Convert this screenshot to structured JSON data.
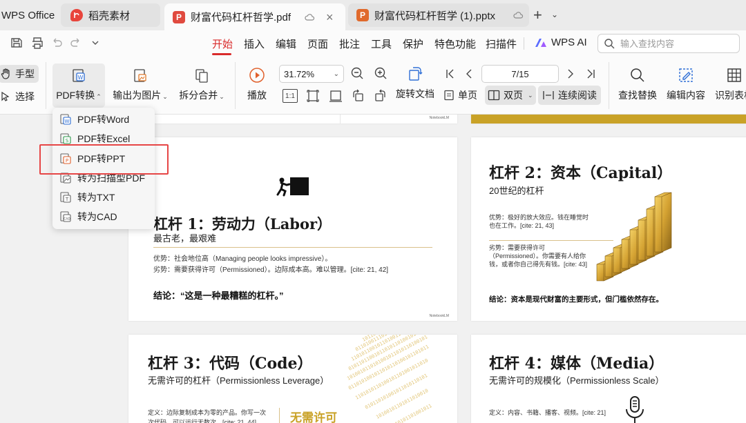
{
  "tabs": {
    "home": "WPS Office",
    "docer": "稻壳素材",
    "active_pdf": "财富代码杠杆哲学.pdf",
    "pptx": "财富代码杠杆哲学 (1).pptx",
    "pdf_badge": "P",
    "pptx_badge": "P"
  },
  "menu": {
    "items": [
      "开始",
      "插入",
      "编辑",
      "页面",
      "批注",
      "工具",
      "保护",
      "特色功能",
      "扫描件"
    ],
    "active": "开始",
    "wps_ai": "WPS AI",
    "search_placeholder": "输入查找内容"
  },
  "ribbon": {
    "hand": "手型",
    "select": "选择",
    "pdf_convert": "PDF转换",
    "export_image": "输出为图片",
    "split_merge": "拆分合并",
    "play": "播放",
    "zoom": "31.72%",
    "rotate_doc": "旋转文档",
    "single_page": "单页",
    "double_page": "双页",
    "continuous": "连续阅读",
    "page_indicator": "7/15",
    "find_replace": "查找替换",
    "edit_content": "编辑内容",
    "recognize_table": "识别表格",
    "actual_size": "1:1"
  },
  "dropdown": {
    "items": [
      "PDF转Word",
      "PDF转Excel",
      "PDF转PPT",
      "转为扫描型PDF",
      "转为TXT",
      "转为CAD"
    ],
    "highlighted": "PDF转PPT"
  },
  "slides": {
    "watermark": "NotebookLM",
    "labor": {
      "title": "杠杆 1：劳动力（Labor）",
      "subtitle": "最古老，最艰难",
      "pro": "优势：社会地位高（Managing people looks impressive）。",
      "con": "劣势：需要获得许可（Permissioned）。边际成本高。难以管理。[cite: 21, 42]",
      "conclusion": "结论：“这是一种最糟糕的杠杆。”"
    },
    "capital": {
      "title": "杠杆 2：资本（Capital）",
      "subtitle": "20世纪的杠杆",
      "pro": "优势：极好的放大效应。钱在睡觉时也在工作。[cite: 21, 43]",
      "con": "劣势：需要获得许可（Permissioned）。你需要有人给你钱，或者你自己得先有钱。[cite: 43]",
      "conclusion": "结论：资本是现代财富的主要形式，但门槛依然存在。"
    },
    "code": {
      "title": "杠杆 3：代码（Code）",
      "subtitle": "无需许可的杠杆（Permissionless Leverage）",
      "definition": "定义：边际复制成本为零的产品。你写一次次代码，可以运行无数次。[cite: 21, 44]",
      "badge": "无需许可"
    },
    "media": {
      "title": "杠杆 4：媒体（Media）",
      "subtitle": "无需许可的规模化（Permissionless Scale）",
      "definition": "定义：内容、书籍、播客、视频。[cite: 21]"
    }
  },
  "colors": {
    "accent_red": "#d92b2b",
    "highlight_box": "#e64545",
    "gold": "#c9a227",
    "pdf_tab": "#e04a3f",
    "pptx_tab": "#e06a2c"
  }
}
